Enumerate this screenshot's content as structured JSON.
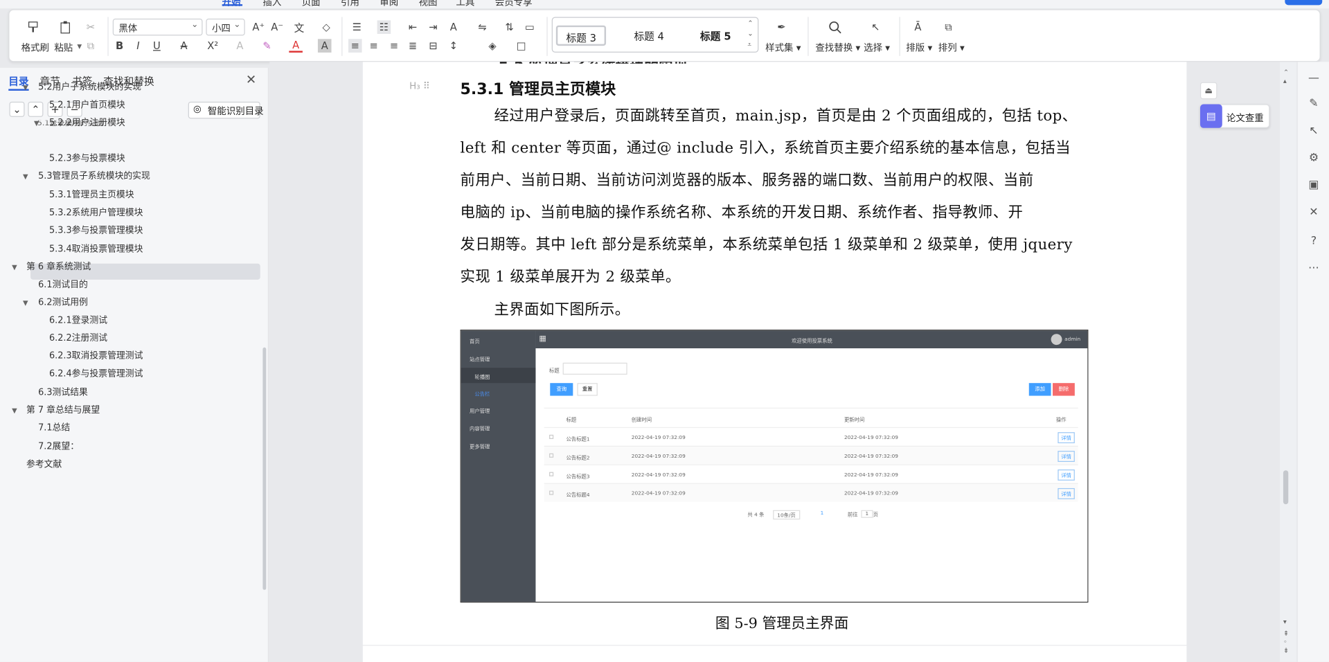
{
  "menubar": {
    "items": [
      "开始",
      "插入",
      "页面",
      "引用",
      "审阅",
      "视图",
      "工具",
      "会员专享"
    ],
    "active": "开始"
  },
  "ribbon": {
    "format_painter": "格式刷",
    "paste": "粘贴",
    "font_family": "黑体",
    "font_size": "小四",
    "styles": [
      "标题 3",
      "标题 4",
      "标题 5"
    ],
    "style_set": "样式集",
    "find_replace": "查找替换",
    "select": "选择",
    "layout": "排版",
    "arrange": "排列",
    "bold": "B",
    "italic": "I",
    "underline": "U"
  },
  "sidebar": {
    "tabs": [
      "目录",
      "章节",
      "书签",
      "查找和替换"
    ],
    "active_tab": "目录",
    "ai_toc": "智能识别目录",
    "toc": [
      {
        "label": "5.2用户子系统模块的实现",
        "level": 2,
        "expanded": true
      },
      {
        "label": "5.2.1用户首页模块",
        "level": 3
      },
      {
        "label": "5.2.2用户注册模块",
        "level": 3,
        "expanded": true
      },
      {
        "label": "5.2.3参与投票模块",
        "level": 3
      },
      {
        "label": "5.3管理员子系统模块的实现",
        "level": 2,
        "expanded": true
      },
      {
        "label": "5.3.1管理员主页模块",
        "level": 3,
        "selected": true
      },
      {
        "label": "5.3.2系统用户管理模块",
        "level": 3
      },
      {
        "label": "5.3.3参与投票管理模块",
        "level": 3
      },
      {
        "label": "5.3.4取消投票管理模块",
        "level": 3
      },
      {
        "label": "第 6 章系统测试",
        "level": 1,
        "expanded": true
      },
      {
        "label": "6.1测试目的",
        "level": 2
      },
      {
        "label": "6.2测试用例",
        "level": 2,
        "expanded": true
      },
      {
        "label": "6.2.1登录测试",
        "level": 3
      },
      {
        "label": "6.2.2注册测试",
        "level": 3
      },
      {
        "label": "6.2.3取消投票管理测试",
        "level": 3
      },
      {
        "label": "6.2.4参与投票管理测试",
        "level": 3
      },
      {
        "label": "6.3测试结果",
        "level": 2
      },
      {
        "label": "第 7 章总结与展望",
        "level": 1,
        "expanded": true
      },
      {
        "label": "7.1总结",
        "level": 2
      },
      {
        "label": "7.2展望：",
        "level": 2
      },
      {
        "label": "参考文献",
        "level": 1
      }
    ]
  },
  "document": {
    "heading": "5.3.1  管理员主页模块",
    "lines": [
      "经过用户登录后，页面跳转至首页，main.jsp，首页是由 2 个页面组成的，包括 top、",
      "left 和 center 等页面，通过@ include 引入，系统首页主要介绍系统的基本信息，包括当",
      "前用户、当前日期、当前访问浏览器的版本、服务器的端口数、当前用户的权限、当前",
      "电脑的 ip、当前电脑的操作系统名称、本系统的开发日期、系统作者、指导教师、开",
      "发日期等。其中 left 部分是系统菜单，本系统菜单包括 1 级菜单和 2 级菜单，使用 jquery",
      "实现 1 级菜单展开为 2 级菜单。"
    ],
    "line2": "主界面如下图所示。",
    "caption": "图 5-9 管理员主界面"
  },
  "screenshot": {
    "header_title": "欢迎使用投票系统",
    "user": "admin",
    "menu": [
      "首页",
      "站点管理",
      "轮播图",
      "公告栏",
      "用户管理",
      "内容管理",
      "更多管理"
    ],
    "search_label": "标题",
    "btn_search": "查询",
    "btn_reset": "重置",
    "btn_add": "添加",
    "btn_delete": "删除",
    "columns": [
      "标题",
      "创建时间",
      "更新时间",
      "操作"
    ],
    "rows": [
      {
        "title": "公告标题1",
        "created": "2022-04-19 07:32:09",
        "updated": "2022-04-19 07:32:09",
        "op": "详情"
      },
      {
        "title": "公告标题2",
        "created": "2022-04-19 07:32:09",
        "updated": "2022-04-19 07:32:09",
        "op": "详情"
      },
      {
        "title": "公告标题3",
        "created": "2022-04-19 07:32:09",
        "updated": "2022-04-19 07:32:09",
        "op": "详情"
      },
      {
        "title": "公告标题4",
        "created": "2022-04-19 07:32:09",
        "updated": "2022-04-19 07:32:09",
        "op": "详情"
      }
    ],
    "pager": {
      "total": "共 4 条",
      "per_page": "10条/页",
      "page": "1",
      "goto": "前往",
      "goto_val": "1",
      "unit": "页"
    }
  },
  "right": {
    "paper_check": "论文查重"
  },
  "colors": {
    "accent": "#2b5fd9",
    "selected_toc": "#dcdee3",
    "check_icon": "#6a6ff0"
  }
}
